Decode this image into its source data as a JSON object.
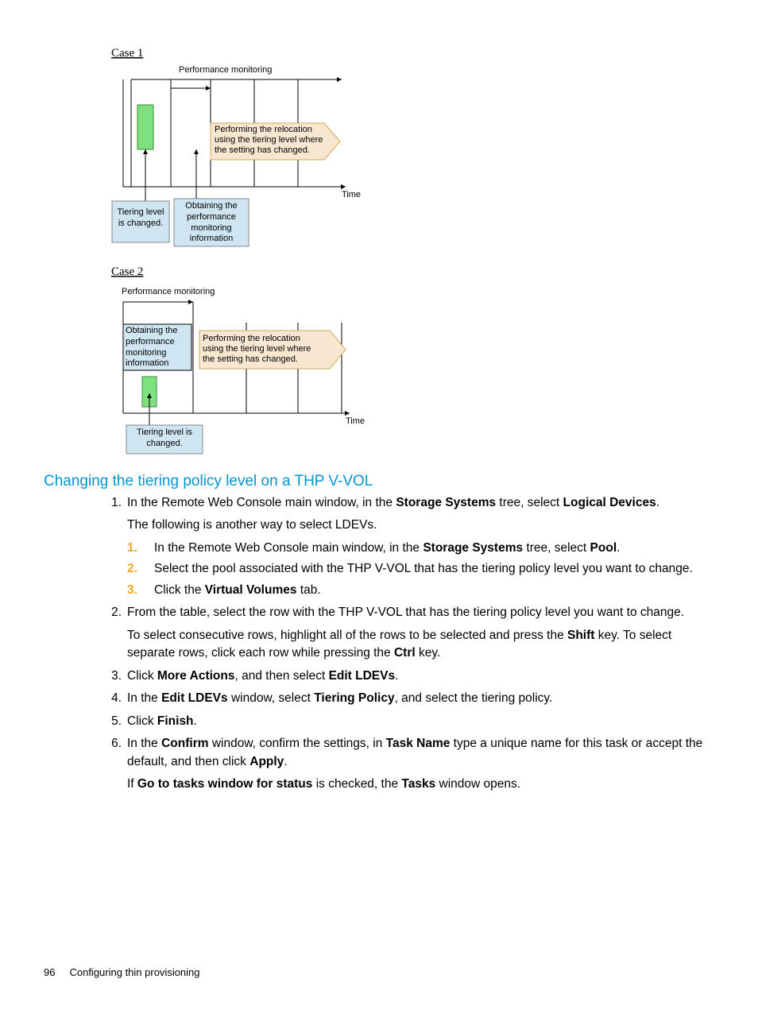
{
  "diagram": {
    "case1": {
      "label": "Case 1",
      "top_label": "Performance monitoring",
      "green_caption": "",
      "blue_left": "Tiering level\nis changed.",
      "blue_right": "Obtaining the\nperformance\nmonitoring\ninformation",
      "orange": "Performing the relocation\nusing the tiering level where\nthe setting has changed.",
      "time_label": "Time"
    },
    "case2": {
      "label": "Case 2",
      "top_label": "Performance monitoring",
      "blue_left_box": "Obtaining the\nperformance\nmonitoring\ninformation",
      "orange": "Performing the relocation\nusing the tiering level where\nthe setting has changed.",
      "blue_bottom": "Tiering level is\nchanged.",
      "time_label": "Time"
    }
  },
  "heading": "Changing the tiering policy level on a THP V-VOL",
  "steps": {
    "s1a": "In the Remote Web Console main window, in the ",
    "s1b": "Storage Systems",
    "s1c": " tree, select ",
    "s1d": "Logical Devices",
    "s1e": ".",
    "s1_follow": "The following is another way to select LDEVs.",
    "sub1a": "In the Remote Web Console main window, in the ",
    "sub1b": "Storage Systems",
    "sub1c": " tree, select ",
    "sub1d": "Pool",
    "sub1e": ".",
    "sub2": "Select the pool associated with the THP V-VOL that has the tiering policy level you want to change.",
    "sub3a": "Click the ",
    "sub3b": "Virtual Volumes",
    "sub3c": " tab.",
    "s2": "From the table, select the row with the THP V-VOL that has the tiering policy level you want to change.",
    "s2_follow_a": "To select consecutive rows, highlight all of the rows to be selected and press the ",
    "s2_follow_b": "Shift",
    "s2_follow_c": " key. To select separate rows, click each row while pressing the ",
    "s2_follow_d": "Ctrl",
    "s2_follow_e": " key.",
    "s3a": "Click ",
    "s3b": "More Actions",
    "s3c": ", and then select ",
    "s3d": "Edit LDEVs",
    "s3e": ".",
    "s4a": "In the ",
    "s4b": "Edit LDEVs",
    "s4c": " window, select ",
    "s4d": "Tiering Policy",
    "s4e": ", and select the tiering policy.",
    "s5a": "Click ",
    "s5b": "Finish",
    "s5c": ".",
    "s6a": "In the ",
    "s6b": "Confirm",
    "s6c": " window, confirm the settings, in ",
    "s6d": "Task Name",
    "s6e": " type a unique name for this task or accept the default, and then click ",
    "s6f": "Apply",
    "s6g": ".",
    "s6_follow_a": "If ",
    "s6_follow_b": "Go to tasks window for status",
    "s6_follow_c": " is checked, the ",
    "s6_follow_d": "Tasks",
    "s6_follow_e": " window opens."
  },
  "footer": {
    "page_number": "96",
    "chapter": "Configuring thin provisioning"
  }
}
